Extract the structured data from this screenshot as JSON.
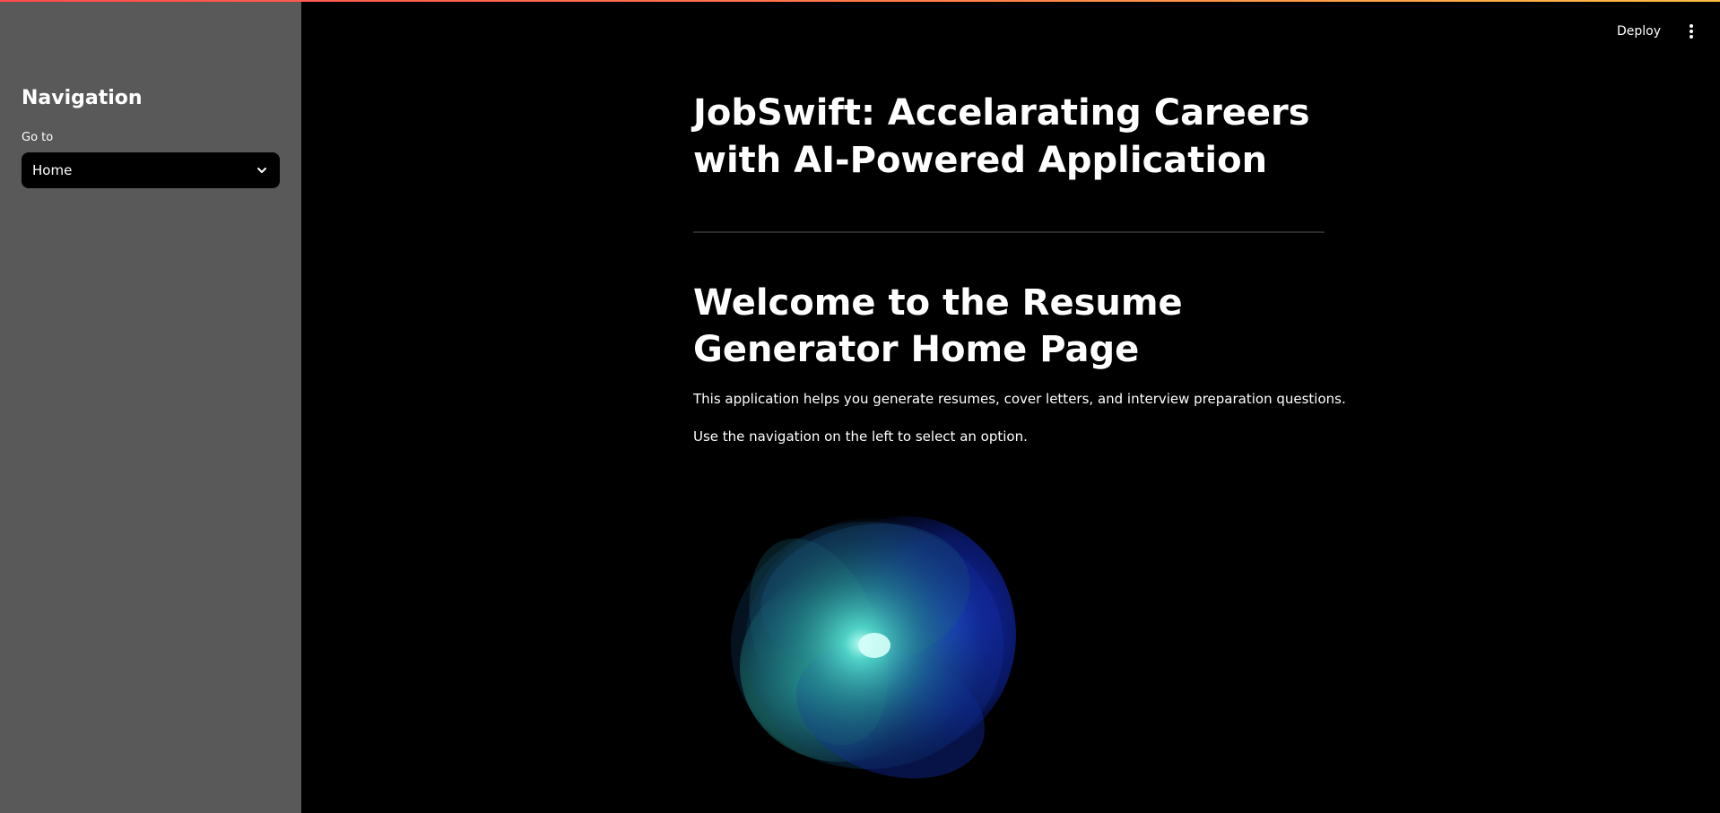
{
  "sidebar": {
    "title": "Navigation",
    "select": {
      "label": "Go to",
      "value": "Home"
    }
  },
  "header": {
    "deploy_label": "Deploy"
  },
  "main": {
    "app_title": "JobSwift: Accelarating Careers with AI-Powered Application",
    "welcome_title": "Welcome to the Resume Generator Home Page",
    "paragraphs": [
      "This application helps you generate resumes, cover letters, and interview preparation questions.",
      "Use the navigation on the left to select an option."
    ]
  },
  "icons": {
    "select_chevron": "chevron-down-icon",
    "more_menu": "more-vertical-icon",
    "orb": "animated-orb-graphic"
  },
  "colors": {
    "sidebar_bg": "#595959",
    "main_bg": "#000000",
    "accent": "#ff4b4b",
    "text": "#ffffff",
    "orb_cyan": "#7fffe8",
    "orb_blue": "#1030d0"
  }
}
